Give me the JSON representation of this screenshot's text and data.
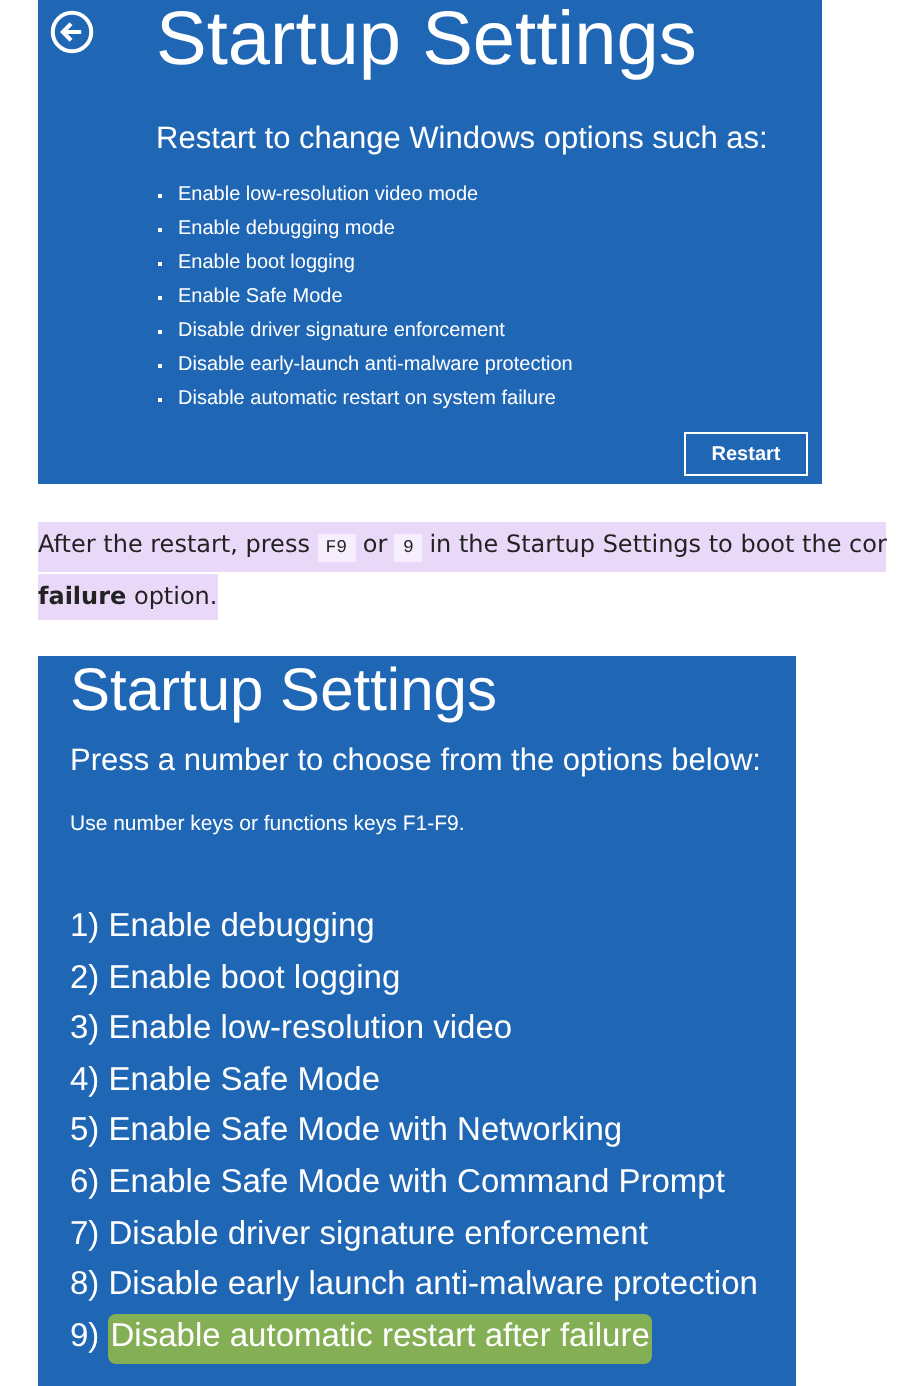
{
  "screen_1": {
    "title": "Startup Settings",
    "subtitle": "Restart to change Windows options such as:",
    "options": [
      "Enable low-resolution video mode",
      "Enable debugging mode",
      "Enable boot logging",
      "Enable Safe Mode",
      "Disable driver signature enforcement",
      "Disable early-launch anti-malware protection",
      "Disable automatic restart on system failure"
    ],
    "button": "Restart"
  },
  "paragraph": {
    "line_1": [
      {
        "kind": "text",
        "text": "After the restart, press "
      },
      {
        "kind": "key",
        "text": "F9"
      },
      {
        "kind": "text",
        "text": " or "
      },
      {
        "kind": "key",
        "text": "9"
      },
      {
        "kind": "text",
        "text": " in the Startup Settings to boot the cor"
      }
    ],
    "line_2": "**failure** option."
  },
  "screen_2": {
    "title": "Startup Settings",
    "prompt": "Press a number to choose from the options below:",
    "hint": "Use number keys or functions keys F1-F9.",
    "options": [
      {
        "number": "1)",
        "label": "Enable debugging",
        "highlighted": false
      },
      {
        "number": "2)",
        "label": "Enable boot logging",
        "highlighted": false
      },
      {
        "number": "3)",
        "label": "Enable low-resolution video",
        "highlighted": false
      },
      {
        "number": "4)",
        "label": "Enable Safe Mode",
        "highlighted": false
      },
      {
        "number": "5)",
        "label": "Enable Safe Mode with Networking",
        "highlighted": false
      },
      {
        "number": "6)",
        "label": "Enable Safe Mode with Command Prompt",
        "highlighted": false
      },
      {
        "number": "7)",
        "label": "Disable driver signature enforcement",
        "highlighted": false
      },
      {
        "number": "8)",
        "label": "Disable early launch anti-malware protection",
        "highlighted": false
      },
      {
        "number": "9)",
        "label": "Disable automatic restart after failure",
        "highlighted": true
      }
    ]
  }
}
